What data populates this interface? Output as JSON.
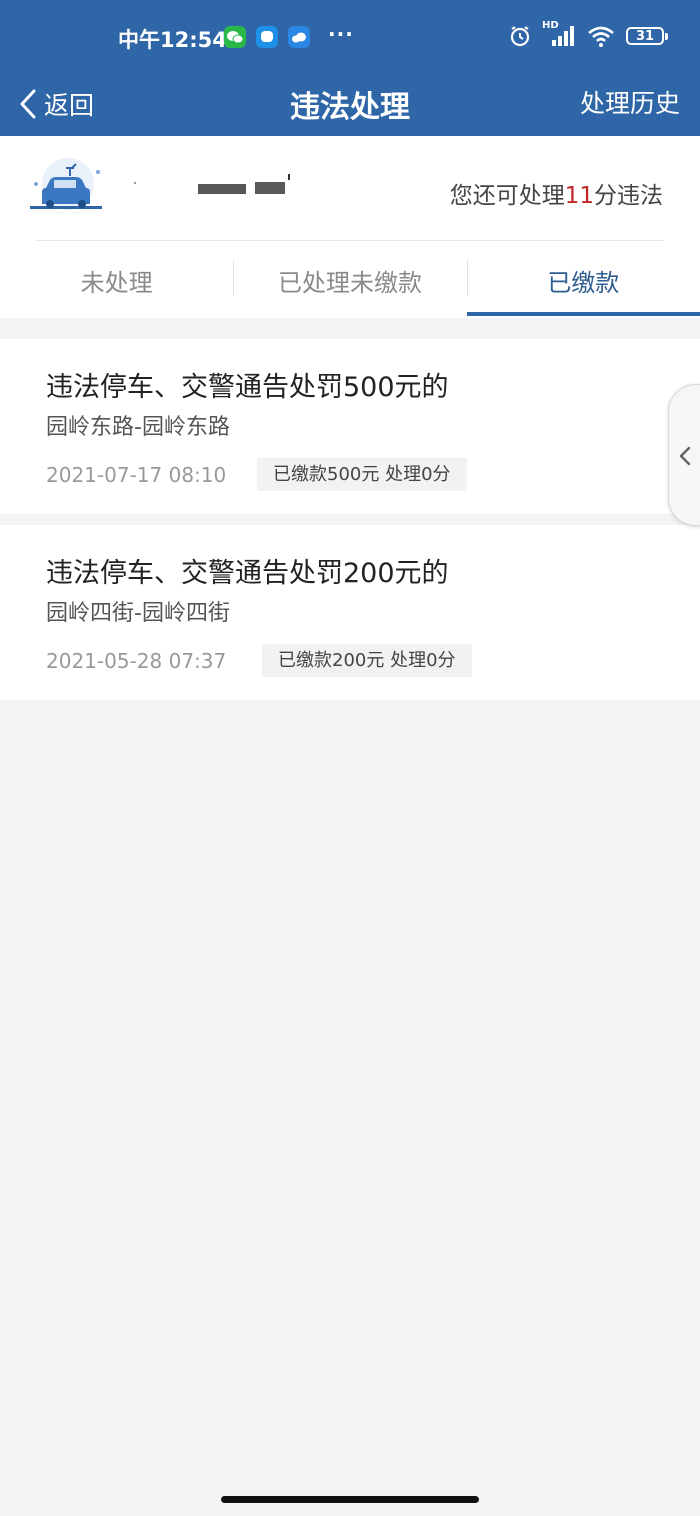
{
  "status_bar": {
    "time": "中午12:54",
    "network": "HD",
    "battery": "31"
  },
  "nav": {
    "back_label": "返回",
    "title": "违法处理",
    "history_label": "处理历史"
  },
  "header": {
    "quota_prefix": "您还可处理",
    "quota_points": "11",
    "quota_suffix": "分违法"
  },
  "tabs": [
    {
      "label": "未处理",
      "active": false
    },
    {
      "label": "已处理未缴款",
      "active": false
    },
    {
      "label": "已缴款",
      "active": true
    }
  ],
  "violations": [
    {
      "title": "违法停车、交警通告处罚500元的",
      "location": "园岭东路-园岭东路",
      "time": "2021-07-17 08:10",
      "status": "已缴款500元 处理0分"
    },
    {
      "title": "违法停车、交警通告处罚200元的",
      "location": "园岭四街-园岭四街",
      "time": "2021-05-28 07:37",
      "status": "已缴款200元 处理0分"
    }
  ],
  "colors": {
    "brand": "#2f66a7",
    "points_highlight": "#c0262b",
    "page_bg": "#f3f4f6"
  }
}
